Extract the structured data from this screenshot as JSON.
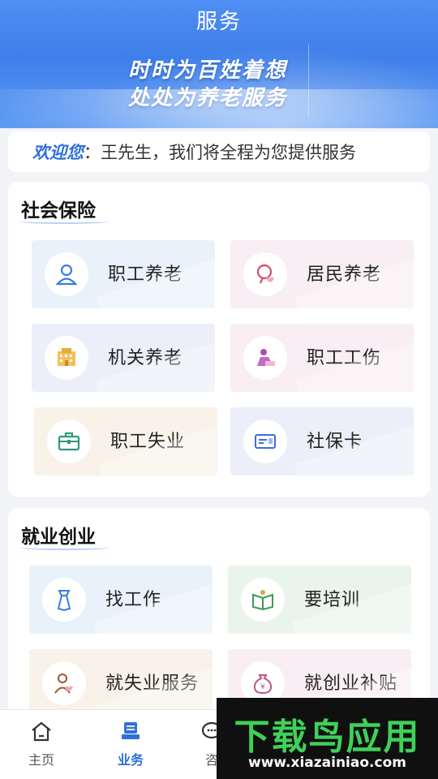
{
  "header": {
    "title": "服务",
    "slogan_line1": "时时为百姓着想",
    "slogan_line2": "处处为养老服务"
  },
  "welcome": {
    "greeting": "欢迎您",
    "message": "：王先生，我们将全程为您提供服务"
  },
  "social_insurance": {
    "title": "社会保险",
    "items": [
      {
        "label": "职工养老",
        "icon": "person-icon"
      },
      {
        "label": "居民养老",
        "icon": "elder-care-icon"
      },
      {
        "label": "机关养老",
        "icon": "building-icon"
      },
      {
        "label": "职工工伤",
        "icon": "injury-icon"
      },
      {
        "label": "职工失业",
        "icon": "briefcase-icon"
      },
      {
        "label": "社保卡",
        "icon": "card-icon"
      }
    ]
  },
  "employment": {
    "title": "就业创业",
    "items": [
      {
        "label": "找工作",
        "icon": "tie-icon"
      },
      {
        "label": "要培训",
        "icon": "book-icon"
      },
      {
        "label": "就失业服务",
        "icon": "worker-icon"
      },
      {
        "label": "就创业补贴",
        "icon": "money-bag-icon"
      }
    ]
  },
  "bottom_nav": {
    "items": [
      {
        "label": "主页",
        "icon": "home-icon",
        "active": false
      },
      {
        "label": "业务",
        "icon": "business-icon",
        "active": true
      },
      {
        "label": "咨",
        "icon": "chat-icon",
        "active": false
      }
    ]
  },
  "watermark": {
    "main": "下载鸟应用",
    "url": "www.xiazainiao.com"
  },
  "colors": {
    "primary": "#2f6fdc",
    "banner": "#4f8ef2",
    "watermark_green": "#3fd158"
  }
}
